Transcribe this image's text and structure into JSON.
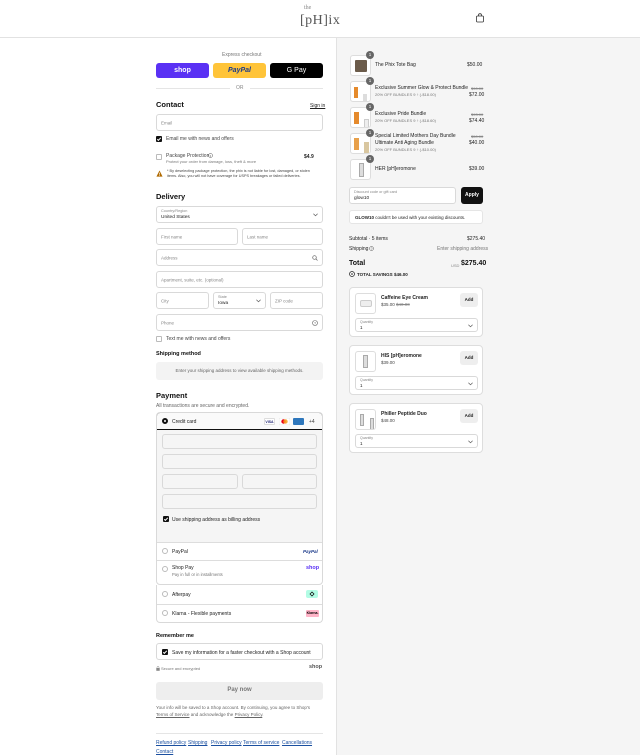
{
  "header": {
    "logo_small": "the",
    "logo_main": "[pH]ix"
  },
  "express": {
    "label": "Express checkout",
    "shop": "shop",
    "paypal": "PayPal",
    "gpay": "G Pay",
    "or": "OR"
  },
  "contact": {
    "title": "Contact",
    "signin": "Sign in",
    "email_placeholder": "Email",
    "email_news": "Email me with news and offers",
    "protection_title": "Package Protection",
    "protection_sub": "Protect your order from damage, loss, theft & more",
    "protection_price": "$4.9",
    "warning": "* By deselecting package protection, the phix is not liable for lost, damaged, or stolen items. Also, you will not have coverage for USPS breakages or failed deliveries."
  },
  "delivery": {
    "title": "Delivery",
    "country_label": "Country/Region",
    "country_value": "United States",
    "first": "First name",
    "last": "Last name",
    "address": "Address",
    "apartment": "Apartment, suite, etc. (optional)",
    "city": "City",
    "state_label": "State",
    "state_value": "Iowa",
    "zip": "ZIP code",
    "phone": "Phone",
    "text_news": "Text me with news and offers"
  },
  "shipping": {
    "title": "Shipping method",
    "note": "Enter your shipping address to view available shipping methods."
  },
  "payment": {
    "title": "Payment",
    "sub": "All transactions are secure and encrypted.",
    "credit": "Credit card",
    "more": "+4",
    "billing": "Use shipping address as billing address",
    "options": [
      "PayPal",
      "Shop Pay",
      "Afterpay",
      "Klarna - Flexible payments"
    ],
    "shoppay_sub": "Pay in full or in installments",
    "paypal_logo": "PayPal",
    "shop_logo": "shop",
    "klarna_logo": "Klarna."
  },
  "remember": {
    "title": "Remember me",
    "save": "Save my information for a faster checkout with a Shop account",
    "secure": "Secure and encrypted",
    "shop_logo": "shop"
  },
  "paynow": "Pay now",
  "legal": {
    "line1": "Your info will be saved to a Shop account. By continuing, you agree to Shop's",
    "terms": "Terms of Service",
    "and": "and acknowledge the",
    "privacy": "Privacy Policy",
    "end": "."
  },
  "footer": {
    "links": [
      "Refund policy",
      "Shipping",
      "Privacy policy",
      "Terms of service",
      "Cancellations",
      "Contact"
    ]
  },
  "cart": {
    "items": [
      {
        "qty": "1",
        "name": "The Phix Tote Bag",
        "name2": "",
        "discount": "",
        "old": "",
        "price": "$50.00"
      },
      {
        "qty": "1",
        "name": "Exclusive Summer Glow & Protect Bundle",
        "name2": "",
        "discount": "20% OFF BUNDLES 9 ↑ (-$18.00)",
        "old": "$90.00",
        "price": "$72.00"
      },
      {
        "qty": "1",
        "name": "Exclusive Pride Bundle",
        "name2": "",
        "discount": "20% OFF BUNDLES 9 ↑ (-$18.60)",
        "old": "$93.00",
        "price": "$74.40"
      },
      {
        "qty": "1",
        "name": "Special Limited Mothers Day Bundle",
        "name2": "Ultimate Anti Aging Bundle",
        "discount": "20% OFF BUNDLES 9 ↑ (-$10.00)",
        "old": "$50.00",
        "price": "$40.00"
      },
      {
        "qty": "1",
        "name": "HER [pH]eromone",
        "name2": "",
        "discount": "",
        "old": "",
        "price": "$39.00"
      }
    ],
    "discount_label": "Discount code or gift card",
    "discount_value": "glow10",
    "apply": "Apply",
    "error_code": "GLOW10",
    "error_msg": "couldn't be used with your existing discounts.",
    "subtotal_label": "Subtotal · 5 items",
    "subtotal": "$275.40",
    "shipping_label": "Shipping",
    "shipping_value": "Enter shipping address",
    "total_label": "Total",
    "currency": "USD",
    "total": "$275.40",
    "savings_label": "TOTAL SAVINGS",
    "savings": "$46.00"
  },
  "upsell": [
    {
      "name": "Caffeine Eye Cream",
      "price": "$35.00",
      "old": "$40.00",
      "add": "Add",
      "qty_label": "Quantity",
      "qty": "1"
    },
    {
      "name": "HIS [pH]eromone",
      "price": "$39.00",
      "old": "",
      "add": "Add",
      "qty_label": "Quantity",
      "qty": "1"
    },
    {
      "name": "Philler Peptide Duo",
      "price": "$48.00",
      "old": "",
      "add": "Add",
      "qty_label": "Quantity",
      "qty": "1"
    }
  ],
  "colors": {
    "shop": "#5a31f4",
    "paypal": "#ffc439",
    "gpay": "#000000",
    "accent": "#111111"
  }
}
